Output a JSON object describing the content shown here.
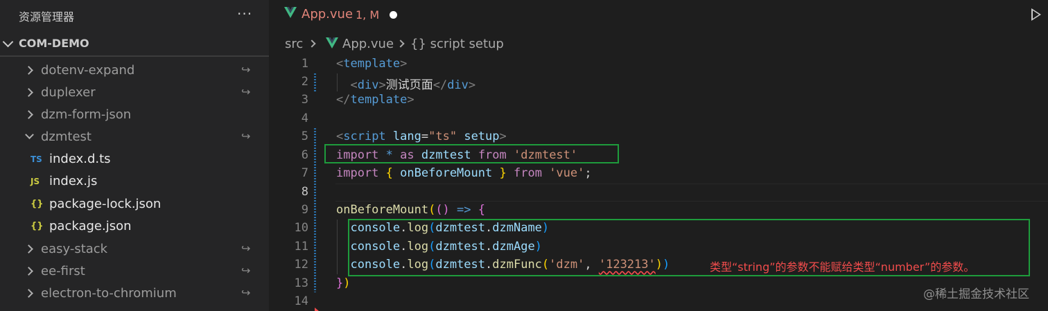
{
  "explorer": {
    "title": "资源管理器",
    "more": "···",
    "root": "COM-DEMO",
    "items": [
      {
        "label": "dotenv-expand",
        "link": "↪"
      },
      {
        "label": "duplexer",
        "link": "↪"
      },
      {
        "label": "dzm-form-json"
      },
      {
        "label": "dzmtest",
        "link": "↪"
      },
      {
        "label": "index.d.ts",
        "icon": "TS"
      },
      {
        "label": "index.js",
        "icon": "JS"
      },
      {
        "label": "package-lock.json",
        "icon": "{}"
      },
      {
        "label": "package.json",
        "icon": "{}"
      },
      {
        "label": "easy-stack",
        "link": "↪"
      },
      {
        "label": "ee-first",
        "link": "↪"
      },
      {
        "label": "electron-to-chromium",
        "link": "↪"
      }
    ]
  },
  "tab": {
    "name": "App.vue",
    "status": "1, M"
  },
  "breadcrumb": {
    "src": "src",
    "file": "App.vue",
    "scope": "{} script setup"
  },
  "lines": [
    "1",
    "2",
    "3",
    "4",
    "5",
    "6",
    "7",
    "8",
    "9",
    "10",
    "11",
    "12",
    "13",
    "14"
  ],
  "code": {
    "l1": {
      "open": "<",
      "tag": "template",
      "close": ">"
    },
    "l2": {
      "open": "<",
      "tag": "div",
      "close": ">",
      "text": "测试页面",
      "open2": "</",
      "tag2": "div",
      "close2": ">"
    },
    "l3": {
      "open": "</",
      "tag": "template",
      "close": ">"
    },
    "l5": {
      "open": "<",
      "tag": "script",
      "attr": "lang",
      "eq": "=",
      "val": "\"ts\"",
      "attr2": "setup",
      "close": ">"
    },
    "l6": {
      "kw": "import",
      "star": "*",
      "as": "as",
      "name": "dzmtest",
      "from": "from",
      "str": "'dzmtest'"
    },
    "l7": {
      "kw": "import",
      "b1": "{",
      "name": "onBeforeMount",
      "b2": "}",
      "from": "from",
      "str": "'vue'",
      "semi": ";"
    },
    "l9": {
      "fn": "onBeforeMount",
      "p1": "(",
      "p2": "()",
      "arrow": "=>",
      "b": "{"
    },
    "l10": {
      "obj": "console",
      "dot": ".",
      "fn": "log",
      "p1": "(",
      "ns": "dzmtest",
      "dot2": ".",
      "prop": "dzmName",
      "p2": ")"
    },
    "l11": {
      "obj": "console",
      "dot": ".",
      "fn": "log",
      "p1": "(",
      "ns": "dzmtest",
      "dot2": ".",
      "prop": "dzmAge",
      "p2": ")"
    },
    "l12": {
      "obj": "console",
      "dot": ".",
      "fn": "log",
      "p1": "(",
      "ns": "dzmtest",
      "dot2": ".",
      "fn2": "dzmFunc",
      "p2": "(",
      "s1": "'dzm'",
      "comma": ",",
      "s2": "'123213'",
      "p3": ")",
      "p4": ")"
    },
    "l13": {
      "b": "}",
      "p": ")"
    }
  },
  "error_message": "类型“string”的参数不能赋给类型“number”的参数。",
  "watermark": "@稀土掘金技术社区",
  "colors": {
    "highlight_box": "#1e9c3c",
    "error": "#f14c4c",
    "tab_modified": "#e2857a"
  }
}
